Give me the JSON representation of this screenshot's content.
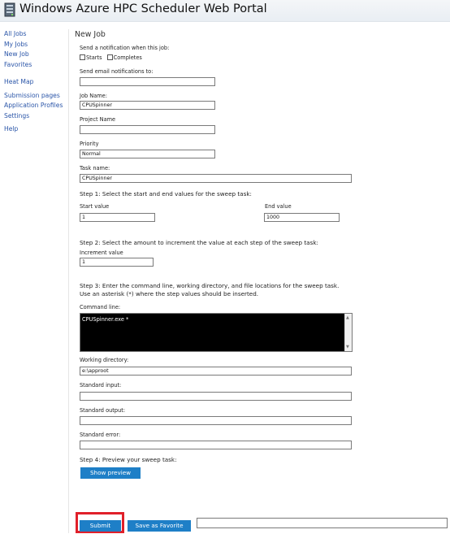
{
  "app": {
    "title": "Windows Azure HPC Scheduler Web Portal"
  },
  "sidebar": {
    "items": [
      {
        "label": "All Jobs"
      },
      {
        "label": "My Jobs"
      },
      {
        "label": "New Job"
      },
      {
        "label": "Favorites"
      },
      {
        "label": "Heat Map"
      },
      {
        "label": "Submission pages"
      },
      {
        "label": "Application Profiles"
      },
      {
        "label": "Settings"
      },
      {
        "label": "Help"
      }
    ]
  },
  "form": {
    "heading": "New Job",
    "notify_label": "Send a notification when this job:",
    "notify_starts": "Starts",
    "notify_completes": "Completes",
    "email_label": "Send email notifications to:",
    "email_value": "",
    "job_name_label": "Job Name:",
    "job_name_value": "CPUSpinner",
    "project_label": "Project Name",
    "project_value": "",
    "priority_label": "Priority",
    "priority_value": "Normal",
    "task_name_label": "Task name:",
    "task_name_value": "CPUSpinner",
    "step1": "Step 1: Select the start and end values for the sweep task:",
    "start_label": "Start value",
    "start_value": "1",
    "end_label": "End value",
    "end_value": "1000",
    "step2": "Step 2: Select the amount to increment the value at each step of the sweep task:",
    "increment_label": "Increment value",
    "increment_value": "1",
    "step3_line1": "Step 3: Enter the command line, working directory, and file locations for the sweep task.",
    "step3_line2": "Use an asterisk (*) where the step values should be inserted.",
    "command_label": "Command line:",
    "command_value": "CPUSpinner.exe *",
    "workdir_label": "Working directory:",
    "workdir_value": "e:\\approot",
    "stdin_label": "Standard input:",
    "stdin_value": "",
    "stdout_label": "Standard output:",
    "stdout_value": "",
    "stderr_label": "Standard error:",
    "stderr_value": "",
    "step4": "Step 4: Preview your sweep task:",
    "show_preview": "Show preview"
  },
  "footer": {
    "submit": "Submit",
    "save_favorite": "Save as Favorite",
    "favorite_name_value": ""
  },
  "colors": {
    "button": "#1e7fc7",
    "link": "#2a55a8",
    "highlight": "#e0202a"
  }
}
